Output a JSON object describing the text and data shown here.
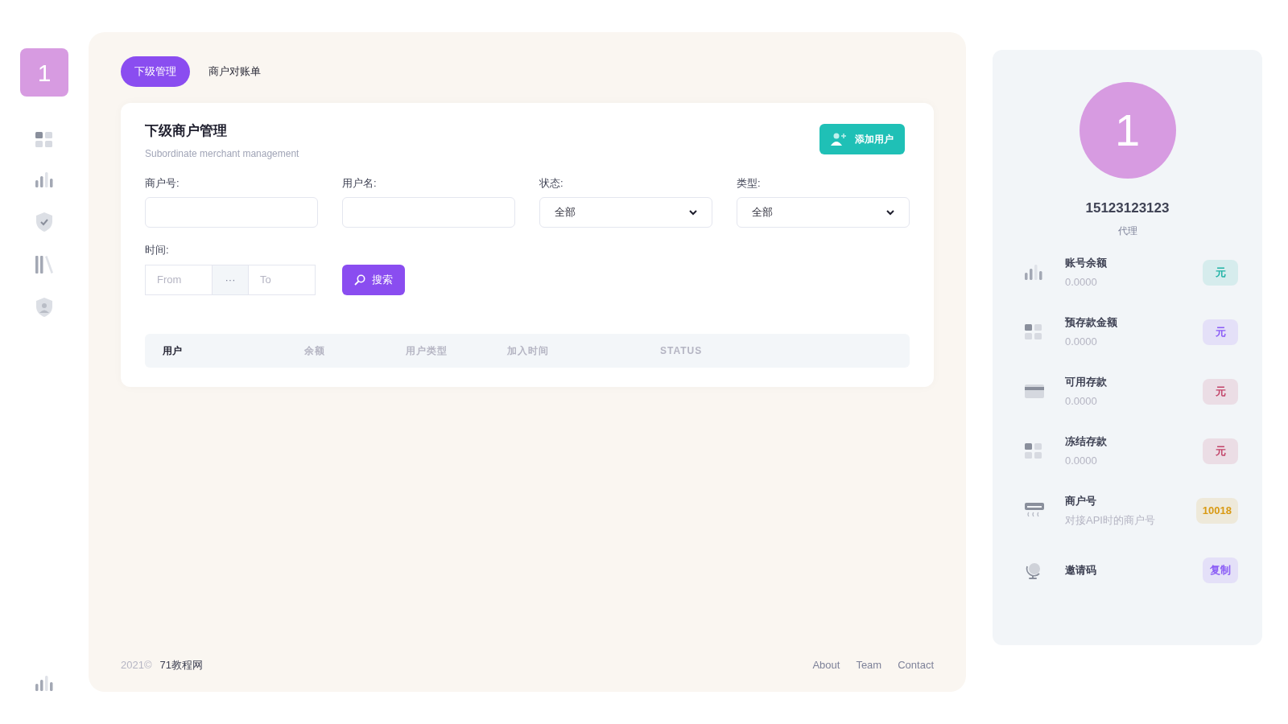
{
  "sidebar": {
    "logo": "1"
  },
  "tabs": [
    {
      "label": "下级管理",
      "selected": true
    },
    {
      "label": "商户对账单",
      "selected": false
    }
  ],
  "card": {
    "title": "下级商户管理",
    "subtitle": "Subordinate merchant management",
    "add_button": "添加用户",
    "filters": [
      {
        "label": "商户号:",
        "kind": "input"
      },
      {
        "label": "用户名:",
        "kind": "input"
      },
      {
        "label": "状态:",
        "kind": "select",
        "value": "全部"
      },
      {
        "label": "类型:",
        "kind": "select",
        "value": "全部"
      }
    ],
    "time": {
      "label": "时间:",
      "from_placeholder": "From",
      "separator": "···",
      "to_placeholder": "To"
    },
    "search_button": "搜索",
    "table": {
      "columns": [
        {
          "label": "用户",
          "bold": true
        },
        {
          "label": "余额",
          "bold": false
        },
        {
          "label": "用户类型",
          "bold": false
        },
        {
          "label": "加入时间",
          "bold": false
        },
        {
          "label": "STATUS",
          "bold": false
        }
      ]
    }
  },
  "footer": {
    "year": "2021©",
    "site": "71教程网",
    "links": [
      "About",
      "Team",
      "Contact"
    ]
  },
  "profile": {
    "avatar": "1",
    "name": "15123123123",
    "role": "代理",
    "stats": [
      {
        "title": "账号余额",
        "value": "0.0000",
        "badge": "元",
        "color": "#22b3a6"
      },
      {
        "title": "预存款金额",
        "value": "0.0000",
        "badge": "元",
        "color": "#8b5cf6"
      },
      {
        "title": "可用存款",
        "value": "0.0000",
        "badge": "元",
        "color": "#c2456a"
      },
      {
        "title": "冻结存款",
        "value": "0.0000",
        "badge": "元",
        "color": "#c2456a"
      },
      {
        "title": "商户号",
        "value": "对接API时的商户号",
        "badge": "10018",
        "color": "#d99a14"
      },
      {
        "title": "邀请码",
        "badge": "复制",
        "color": "#8b5cf6"
      }
    ]
  }
}
